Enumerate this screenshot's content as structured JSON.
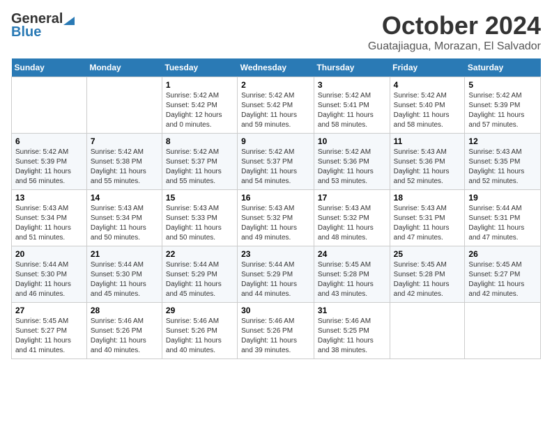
{
  "logo": {
    "general": "General",
    "blue": "Blue"
  },
  "header": {
    "month": "October 2024",
    "location": "Guatajiagua, Morazan, El Salvador"
  },
  "weekdays": [
    "Sunday",
    "Monday",
    "Tuesday",
    "Wednesday",
    "Thursday",
    "Friday",
    "Saturday"
  ],
  "weeks": [
    [
      null,
      null,
      {
        "day": "1",
        "sunrise": "5:42 AM",
        "sunset": "5:42 PM",
        "daylight": "12 hours and 0 minutes."
      },
      {
        "day": "2",
        "sunrise": "5:42 AM",
        "sunset": "5:42 PM",
        "daylight": "11 hours and 59 minutes."
      },
      {
        "day": "3",
        "sunrise": "5:42 AM",
        "sunset": "5:41 PM",
        "daylight": "11 hours and 58 minutes."
      },
      {
        "day": "4",
        "sunrise": "5:42 AM",
        "sunset": "5:40 PM",
        "daylight": "11 hours and 58 minutes."
      },
      {
        "day": "5",
        "sunrise": "5:42 AM",
        "sunset": "5:39 PM",
        "daylight": "11 hours and 57 minutes."
      }
    ],
    [
      {
        "day": "6",
        "sunrise": "5:42 AM",
        "sunset": "5:39 PM",
        "daylight": "11 hours and 56 minutes."
      },
      {
        "day": "7",
        "sunrise": "5:42 AM",
        "sunset": "5:38 PM",
        "daylight": "11 hours and 55 minutes."
      },
      {
        "day": "8",
        "sunrise": "5:42 AM",
        "sunset": "5:37 PM",
        "daylight": "11 hours and 55 minutes."
      },
      {
        "day": "9",
        "sunrise": "5:42 AM",
        "sunset": "5:37 PM",
        "daylight": "11 hours and 54 minutes."
      },
      {
        "day": "10",
        "sunrise": "5:42 AM",
        "sunset": "5:36 PM",
        "daylight": "11 hours and 53 minutes."
      },
      {
        "day": "11",
        "sunrise": "5:43 AM",
        "sunset": "5:36 PM",
        "daylight": "11 hours and 52 minutes."
      },
      {
        "day": "12",
        "sunrise": "5:43 AM",
        "sunset": "5:35 PM",
        "daylight": "11 hours and 52 minutes."
      }
    ],
    [
      {
        "day": "13",
        "sunrise": "5:43 AM",
        "sunset": "5:34 PM",
        "daylight": "11 hours and 51 minutes."
      },
      {
        "day": "14",
        "sunrise": "5:43 AM",
        "sunset": "5:34 PM",
        "daylight": "11 hours and 50 minutes."
      },
      {
        "day": "15",
        "sunrise": "5:43 AM",
        "sunset": "5:33 PM",
        "daylight": "11 hours and 50 minutes."
      },
      {
        "day": "16",
        "sunrise": "5:43 AM",
        "sunset": "5:32 PM",
        "daylight": "11 hours and 49 minutes."
      },
      {
        "day": "17",
        "sunrise": "5:43 AM",
        "sunset": "5:32 PM",
        "daylight": "11 hours and 48 minutes."
      },
      {
        "day": "18",
        "sunrise": "5:43 AM",
        "sunset": "5:31 PM",
        "daylight": "11 hours and 47 minutes."
      },
      {
        "day": "19",
        "sunrise": "5:44 AM",
        "sunset": "5:31 PM",
        "daylight": "11 hours and 47 minutes."
      }
    ],
    [
      {
        "day": "20",
        "sunrise": "5:44 AM",
        "sunset": "5:30 PM",
        "daylight": "11 hours and 46 minutes."
      },
      {
        "day": "21",
        "sunrise": "5:44 AM",
        "sunset": "5:30 PM",
        "daylight": "11 hours and 45 minutes."
      },
      {
        "day": "22",
        "sunrise": "5:44 AM",
        "sunset": "5:29 PM",
        "daylight": "11 hours and 45 minutes."
      },
      {
        "day": "23",
        "sunrise": "5:44 AM",
        "sunset": "5:29 PM",
        "daylight": "11 hours and 44 minutes."
      },
      {
        "day": "24",
        "sunrise": "5:45 AM",
        "sunset": "5:28 PM",
        "daylight": "11 hours and 43 minutes."
      },
      {
        "day": "25",
        "sunrise": "5:45 AM",
        "sunset": "5:28 PM",
        "daylight": "11 hours and 42 minutes."
      },
      {
        "day": "26",
        "sunrise": "5:45 AM",
        "sunset": "5:27 PM",
        "daylight": "11 hours and 42 minutes."
      }
    ],
    [
      {
        "day": "27",
        "sunrise": "5:45 AM",
        "sunset": "5:27 PM",
        "daylight": "11 hours and 41 minutes."
      },
      {
        "day": "28",
        "sunrise": "5:46 AM",
        "sunset": "5:26 PM",
        "daylight": "11 hours and 40 minutes."
      },
      {
        "day": "29",
        "sunrise": "5:46 AM",
        "sunset": "5:26 PM",
        "daylight": "11 hours and 40 minutes."
      },
      {
        "day": "30",
        "sunrise": "5:46 AM",
        "sunset": "5:26 PM",
        "daylight": "11 hours and 39 minutes."
      },
      {
        "day": "31",
        "sunrise": "5:46 AM",
        "sunset": "5:25 PM",
        "daylight": "11 hours and 38 minutes."
      },
      null,
      null
    ]
  ]
}
